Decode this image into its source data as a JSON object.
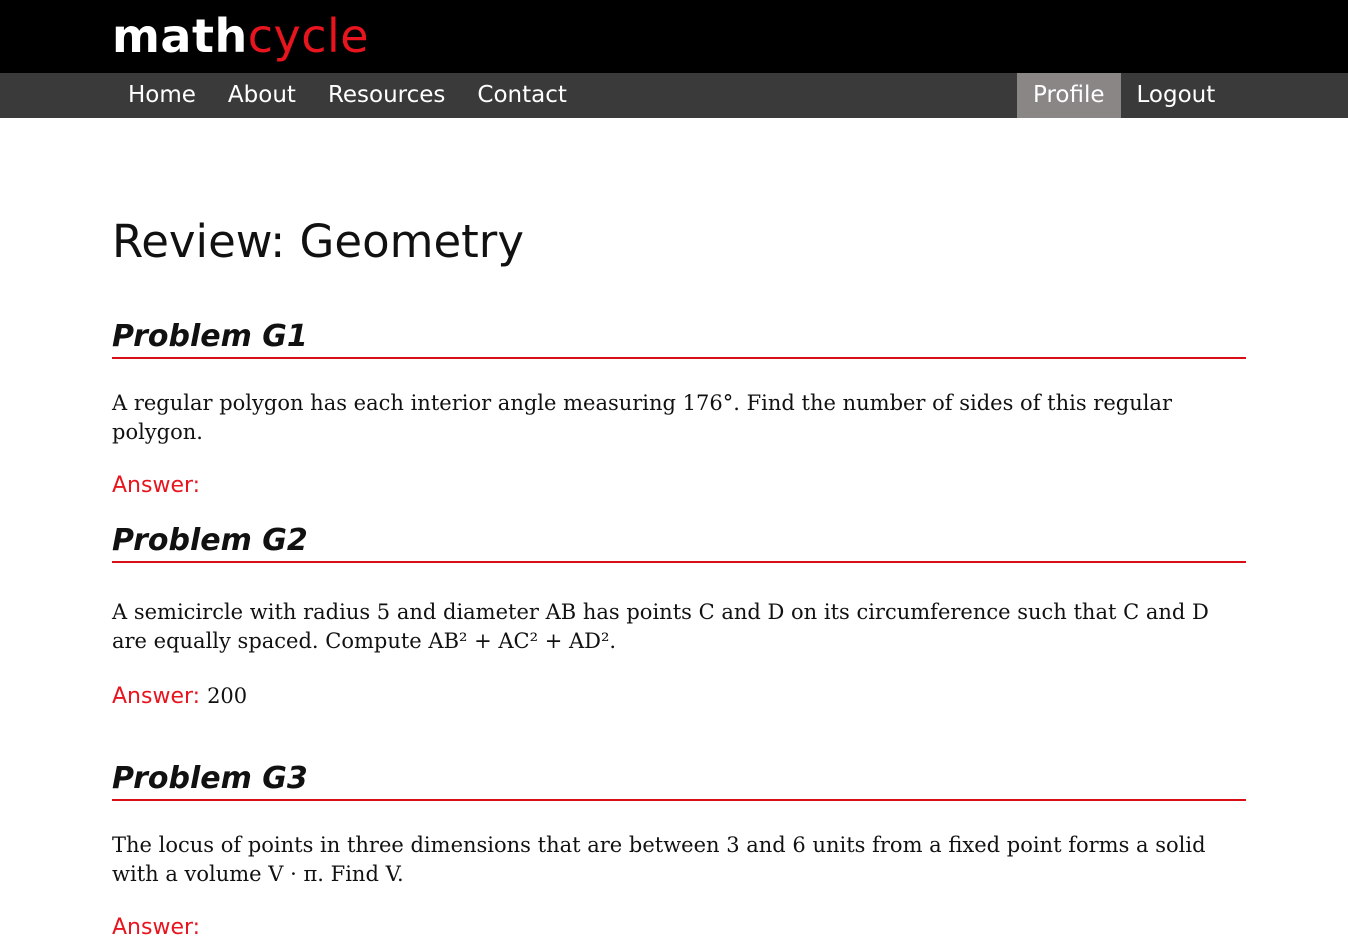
{
  "brand": {
    "part1": "math",
    "part2": "cycle"
  },
  "nav": {
    "left": [
      "Home",
      "About",
      "Resources",
      "Contact"
    ],
    "right": [
      "Profile",
      "Logout"
    ],
    "active": "Profile"
  },
  "page_title": "Review: Geometry",
  "problems": [
    {
      "title": "Problem G1",
      "text": "A regular polygon has each interior angle measuring 176°. Find the number of sides of this regular polygon.",
      "answer_label": "Answer:",
      "answer_value": ""
    },
    {
      "title": "Problem G2",
      "text": "A semicircle with radius 5 and diameter AB has points C and D on its circumference such that C and D are equally spaced. Compute AB² + AC² + AD².",
      "answer_label": "Answer:",
      "answer_value": "200"
    },
    {
      "title": "Problem G3",
      "text": "The locus of points in three dimensions that are between 3 and 6 units from a fixed point forms a solid with a volume V · π. Find V.",
      "answer_label": "Answer:",
      "answer_value": ""
    }
  ],
  "colors": {
    "accent": "#e8141e",
    "topbar": "#000000",
    "navbar": "#3a3a3a",
    "active_nav": "#8a8686"
  }
}
